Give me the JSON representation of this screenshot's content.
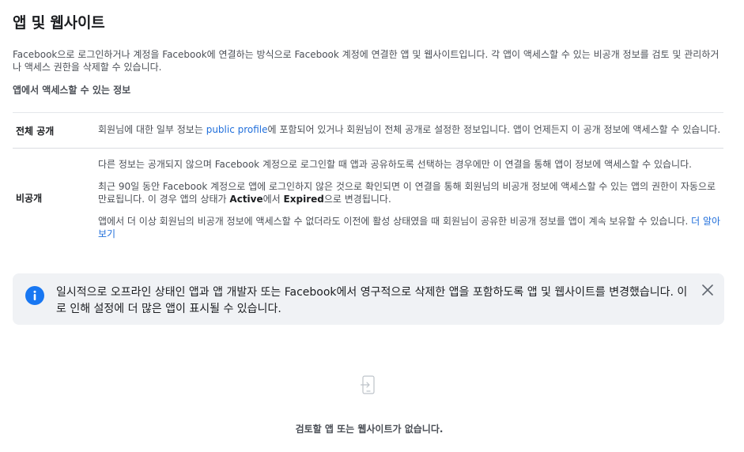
{
  "page": {
    "title": "앱 및 웹사이트",
    "description": "Facebook으로 로그인하거나 계정을 Facebook에 연결하는 방식으로 Facebook 계정에 연결한 앱 및 웹사이트입니다. 각 앱이 액세스할 수 있는 비공개 정보를 검토 및 관리하거나 액세스 권한을 삭제할 수 있습니다.",
    "section_title": "앱에서 액세스할 수 있는 정보"
  },
  "info_table": {
    "public": {
      "label": "전체 공개",
      "text_before": "회원님에 대한 일부 정보는 ",
      "link": "public profile",
      "text_after": "에 포함되어 있거나 회원님이 전체 공개로 설정한 정보입니다. 앱이 언제든지 이 공개 정보에 액세스할 수 있습니다."
    },
    "private": {
      "label": "비공개",
      "p1": "다른 정보는 공개되지 않으며 Facebook 계정으로 로그인할 때 앱과 공유하도록 선택하는 경우에만 이 연결을 통해 앱이 정보에 액세스할 수 있습니다.",
      "p2_a": "최근 90일 동안 Facebook 계정으로 앱에 로그인하지 않은 것으로 확인되면 이 연결을 통해 회원님의 비공개 정보에 액세스할 수 있는 앱의 권한이 자동으로 만료됩니다. 이 경우 앱의 상태가 ",
      "p2_active": "Active",
      "p2_b": "에서 ",
      "p2_expired": "Expired",
      "p2_c": "으로 변경됩니다.",
      "p3": "앱에서 더 이상 회원님의 비공개 정보에 액세스할 수 없더라도 이전에 활성 상태였을 때 회원님이 공유한 비공개 정보를 앱이 계속 보유할 수 있습니다. ",
      "p3_link": "더 알아보기"
    }
  },
  "banner": {
    "icon": "info-icon",
    "text": "일시적으로 오프라인 상태인 앱과 앱 개발자 또는 Facebook에서 영구적으로 삭제한 앱을 포함하도록 앱 및 웹사이트를 변경했습니다. 이로 인해 설정에 더 많은 앱이 표시될 수 있습니다.",
    "close_icon": "close-icon"
  },
  "empty_state": {
    "icon": "phone-login-icon",
    "text": "검토할 앱 또는 웹사이트가 없습니다."
  },
  "colors": {
    "accent": "#1877f2",
    "link": "#216fdb",
    "banner_bg": "#f0f2f5",
    "divider": "#dadde1"
  }
}
